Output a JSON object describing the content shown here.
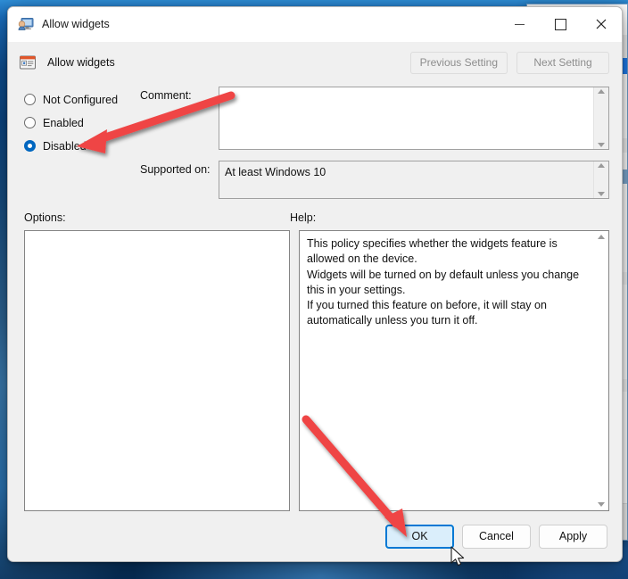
{
  "window": {
    "title": "Allow widgets",
    "title_icon": "computer-policy-icon",
    "caption": {
      "minimize": "—",
      "maximize": "☐",
      "close": "✕"
    }
  },
  "header": {
    "setting_name": "Allow widgets",
    "setting_icon": "policy-setting-icon",
    "previous_setting_label": "Previous Setting",
    "next_setting_label": "Next Setting"
  },
  "state_options": [
    {
      "label": "Not Configured",
      "selected": false
    },
    {
      "label": "Enabled",
      "selected": false
    },
    {
      "label": "Disabled",
      "selected": true
    }
  ],
  "fields": {
    "comment_label": "Comment:",
    "comment_value": "",
    "supported_label": "Supported on:",
    "supported_value": "At least Windows 10"
  },
  "panels": {
    "options_label": "Options:",
    "options_value": "",
    "help_label": "Help:",
    "help_text": "This policy specifies whether the widgets feature is allowed on the device.\nWidgets will be turned on by default unless you change this in your settings.\nIf you turned this feature on before, it will stay on automatically unless you turn it off."
  },
  "footer": {
    "ok_label": "OK",
    "cancel_label": "Cancel",
    "apply_label": "Apply"
  },
  "annotations": {
    "accent_color": "#ef4444",
    "arrow_one_target": "Disabled radio button",
    "arrow_two_target": "OK button"
  },
  "colors": {
    "dialog_background": "#f0f0f0",
    "titlebar_background": "#ffffff",
    "accent_blue": "#0067c0",
    "focus_blue": "#0078d4",
    "ok_hover_fill": "#daeefb",
    "desktop_blue": "#0b4a86"
  }
}
